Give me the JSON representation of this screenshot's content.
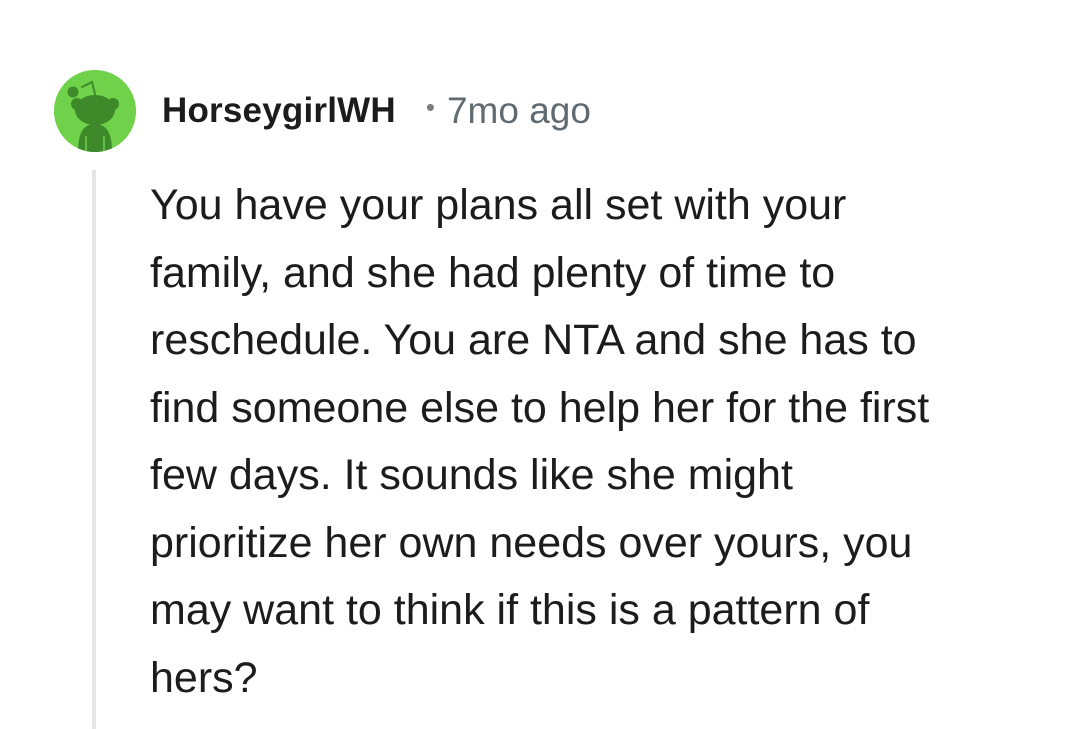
{
  "comment": {
    "author": "HorseygirlWH",
    "separator": "•",
    "timestamp": "7mo ago",
    "avatar_icon": "snoo-avatar-icon",
    "avatar_color": "#6fd24a",
    "body_lines": [
      "You have your plans all set with your",
      "family, and she had plenty of time to",
      "reschedule. You are NTA and she has to",
      "find someone else to help her for the first",
      "few days. It sounds like she might",
      "prioritize her own needs over yours, you",
      "may want to think if this is a pattern of",
      "hers?"
    ]
  }
}
